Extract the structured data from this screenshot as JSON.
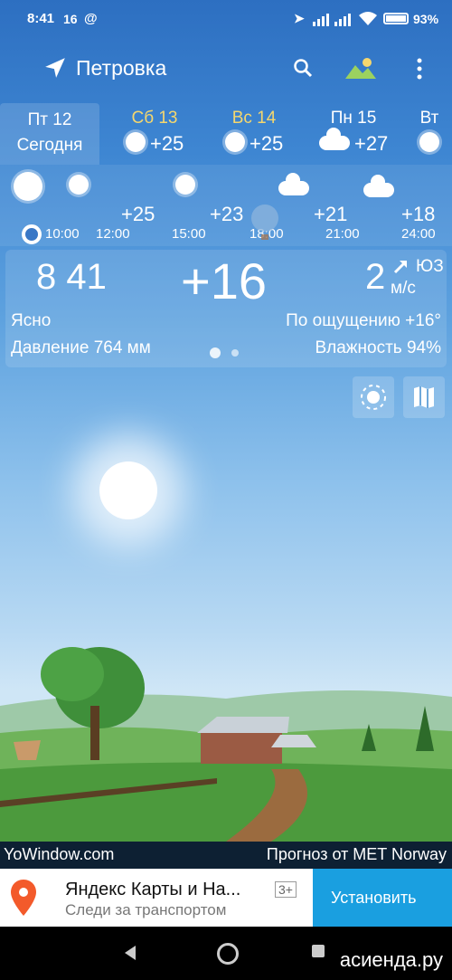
{
  "status": {
    "time": "8:41",
    "temp": "16",
    "at": "@",
    "battery": "93%"
  },
  "toolbar": {
    "location": "Петровка"
  },
  "days": [
    {
      "name": "Пт 12",
      "sub": "Сегодня",
      "temp": "",
      "icon": "none",
      "selected": true
    },
    {
      "name": "Сб 13",
      "sub": "",
      "temp": "+25",
      "icon": "sun-cloud-icon"
    },
    {
      "name": "Вс 14",
      "sub": "",
      "temp": "+25",
      "icon": "sun-cloud-icon"
    },
    {
      "name": "Пн 15",
      "sub": "",
      "temp": "+27",
      "icon": "cloud-icon"
    },
    {
      "name": "Вт",
      "sub": "",
      "temp": "",
      "icon": "sun-cloud-icon"
    }
  ],
  "hourly": {
    "now_time": "10:00",
    "times": [
      "12:00",
      "15:00",
      "18:00",
      "21:00",
      "24:00"
    ],
    "temps": [
      "+25",
      "+23",
      "+21",
      "+18"
    ]
  },
  "current": {
    "time": "8 41",
    "temp": "+16",
    "wind_speed": "2",
    "wind_dir": "ЮЗ",
    "wind_unit": "м/с",
    "condition": "Ясно",
    "feels_like": "По ощущению +16°",
    "pressure": "Давление 764 мм",
    "humidity": "Влажность 94%"
  },
  "footer": {
    "brand": "YoWindow.com",
    "source": "Прогноз от MET Norway"
  },
  "ad": {
    "title": "Яндекс Карты и На...",
    "subtitle": "Следи за транспортом",
    "age": "3+",
    "install": "Установить"
  },
  "watermark": "асиенда.ру",
  "colors": {
    "accent_yellow": "#f5d76e",
    "install_bg": "#1a9fe0",
    "map_pin": "#f35a2b"
  }
}
